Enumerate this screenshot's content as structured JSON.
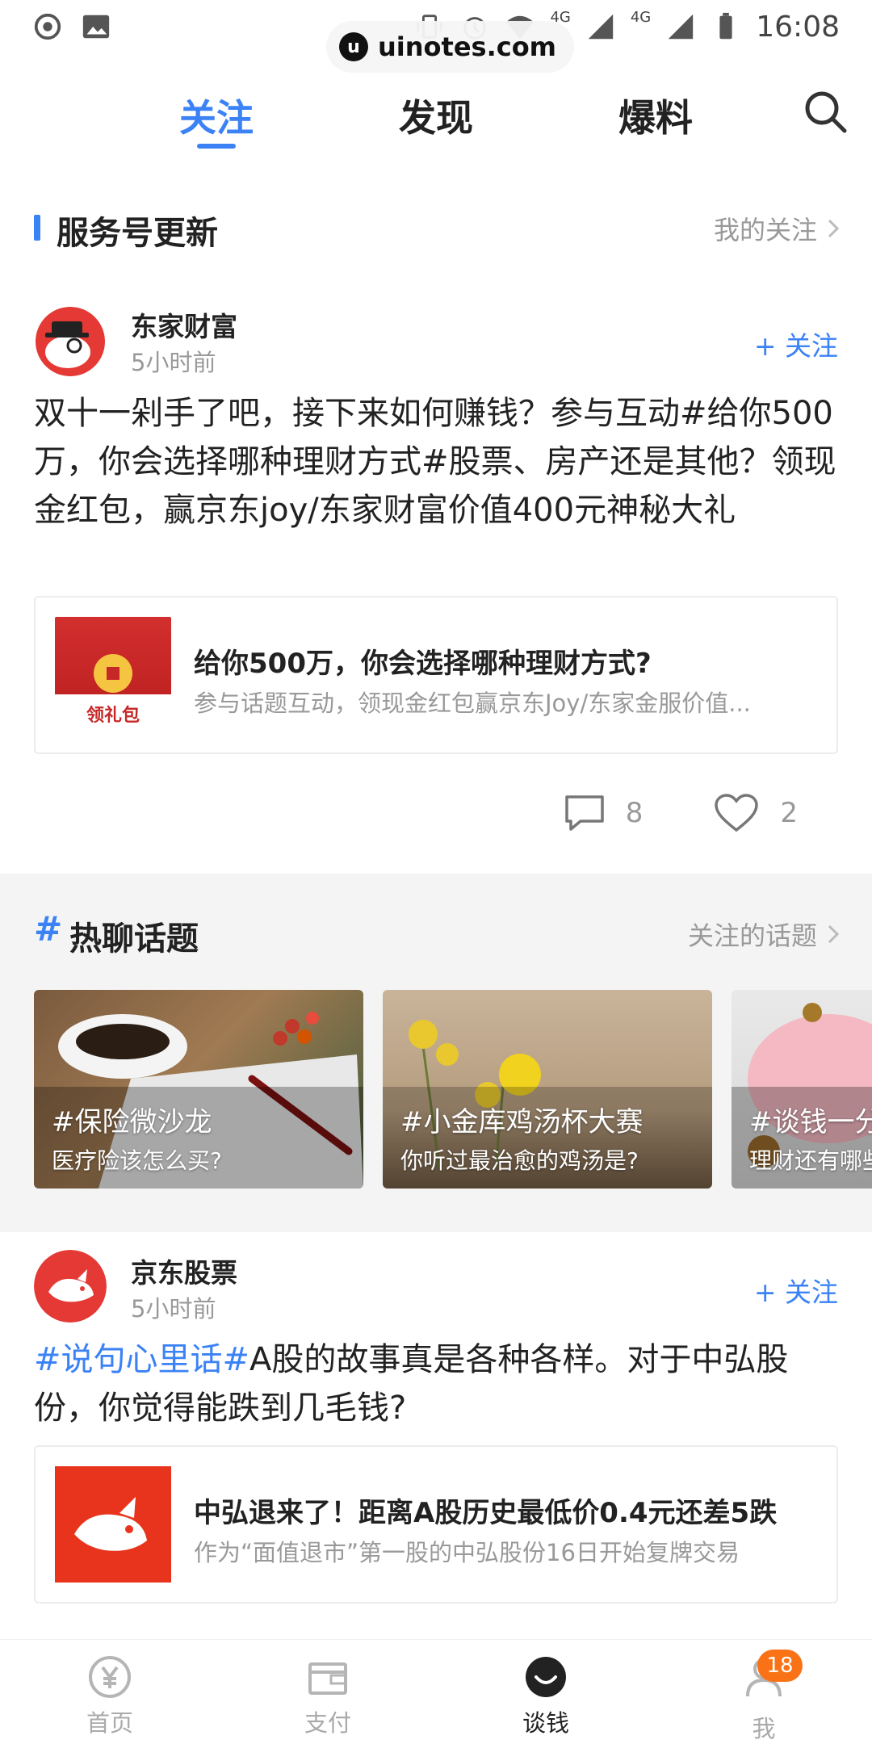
{
  "status_bar": {
    "time": "16:08",
    "net_1": "4G",
    "net_2": "4G"
  },
  "watermark": {
    "text": "uinotes.com",
    "logo": "u"
  },
  "top_tabs": [
    {
      "label": "关注",
      "active": true
    },
    {
      "label": "发现",
      "active": false
    },
    {
      "label": "爆料",
      "active": false
    }
  ],
  "service_section": {
    "title": "服务号更新",
    "link": "我的关注"
  },
  "post1": {
    "author": "东家财富",
    "time": "5小时前",
    "follow": "+ 关注",
    "text": "双十一剁手了吧，接下来如何赚钱？参与互动#给你500万，你会选择哪种理财方式#股票、房产还是其他？领现金红包，赢京东joy/东家财富价值400元神秘大礼",
    "card": {
      "thumb_label": "领礼包",
      "title": "给你500万，你会选择哪种理财方式?",
      "subtitle": "参与话题互动，领现金红包赢京东Joy/东家金服价值..."
    },
    "comments": "8",
    "likes": "2"
  },
  "topics_section": {
    "hash": "#",
    "title": "热聊话题",
    "link": "关注的话题",
    "topics": [
      {
        "title": "#保险微沙龙",
        "subtitle": "医疗险该怎么买?"
      },
      {
        "title": "#小金库鸡汤杯大赛",
        "subtitle": "你听过最治愈的鸡汤是?"
      },
      {
        "title": "#谈钱一分",
        "subtitle": "理财还有哪些"
      }
    ]
  },
  "post2": {
    "author": "京东股票",
    "time": "5小时前",
    "follow": "+ 关注",
    "text_hashtag": "#说句心里话#",
    "text_body": "A股的故事真是各种各样。对于中弘股份，你觉得能跌到几毛钱?",
    "card": {
      "title": "中弘退来了！距离A股历史最低价0.4元还差5跌",
      "subtitle": "作为“面值退市”第一股的中弘股份16日开始复牌交易"
    }
  },
  "bottom_nav": [
    {
      "label": "首页",
      "active": false
    },
    {
      "label": "支付",
      "active": false
    },
    {
      "label": "谈钱",
      "active": true
    },
    {
      "label": "我",
      "active": false,
      "badge": "18"
    }
  ],
  "colors": {
    "accent": "#3b82f6",
    "badge": "#f97316",
    "muted": "#999999"
  }
}
